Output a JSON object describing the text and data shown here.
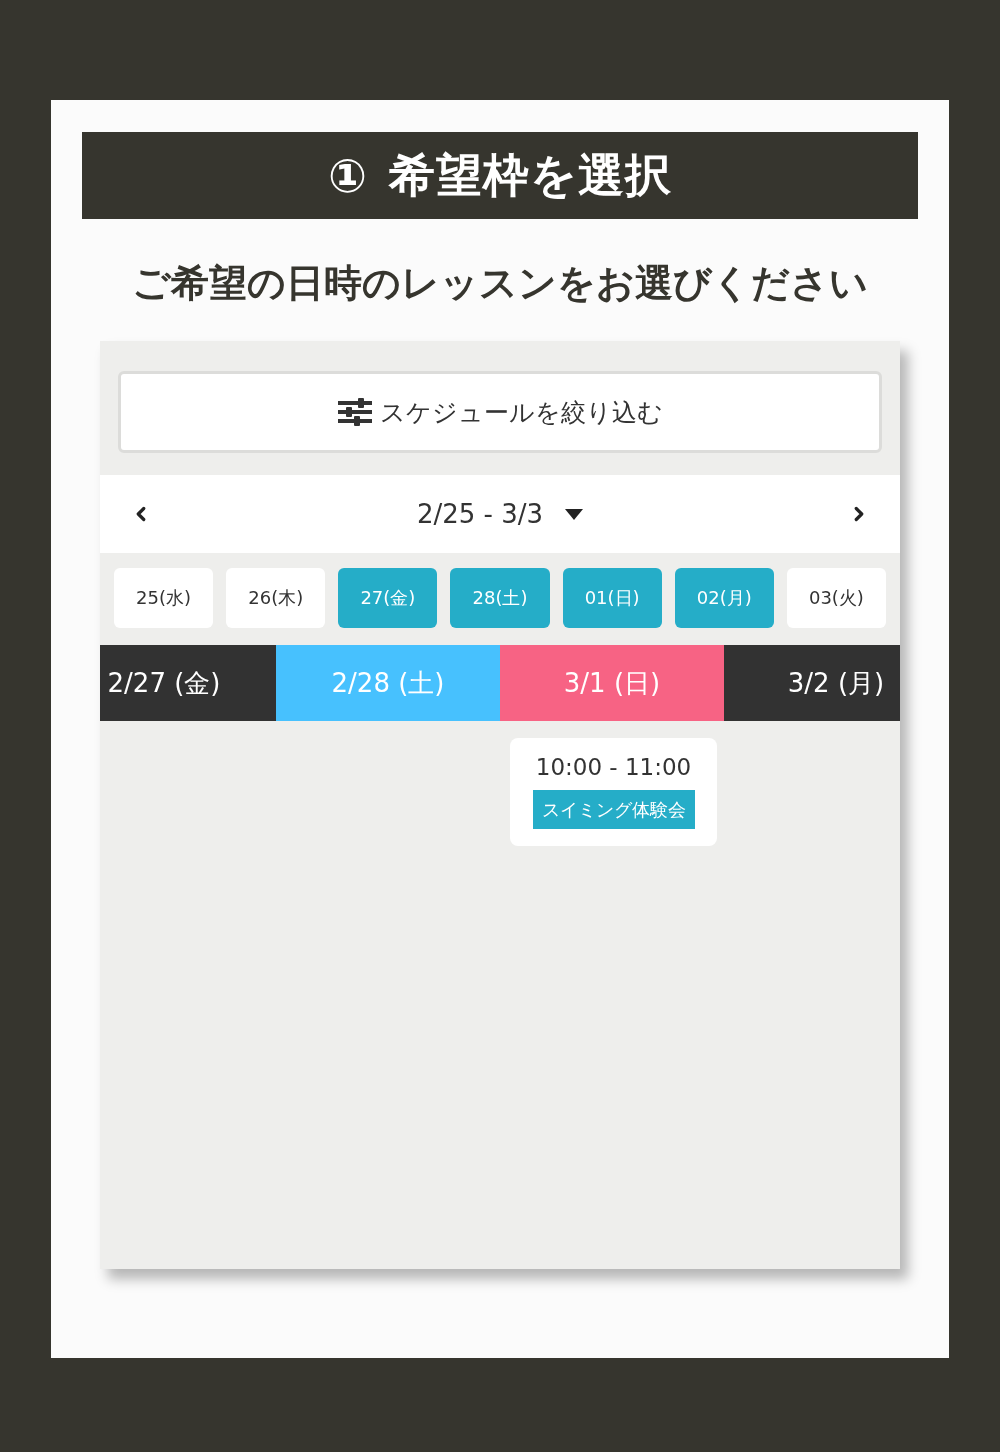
{
  "header": {
    "step": "①",
    "title": "希望枠を選択"
  },
  "subtitle": "ご希望の日時のレッスンをお選びください",
  "filter_button": {
    "label": "スケジュールを絞り込む"
  },
  "week_nav": {
    "range": "2/25 - 3/3"
  },
  "days": [
    {
      "label": "25(水)",
      "selected": false
    },
    {
      "label": "26(木)",
      "selected": false
    },
    {
      "label": "27(金)",
      "selected": true
    },
    {
      "label": "28(土)",
      "selected": true
    },
    {
      "label": "01(日)",
      "selected": true
    },
    {
      "label": "02(月)",
      "selected": true
    },
    {
      "label": "03(火)",
      "selected": false
    }
  ],
  "columns": [
    {
      "label": "2/27 (金)",
      "color": "#323232"
    },
    {
      "label": "2/28 (土)",
      "color": "#47c1fe"
    },
    {
      "label": "3/1 (日)",
      "color": "#f76384",
      "lessons": [
        {
          "time": "10:00 - 11:00",
          "title": "スイミング体験会"
        }
      ]
    },
    {
      "label": "3/2 (月)",
      "color": "#323232"
    }
  ]
}
